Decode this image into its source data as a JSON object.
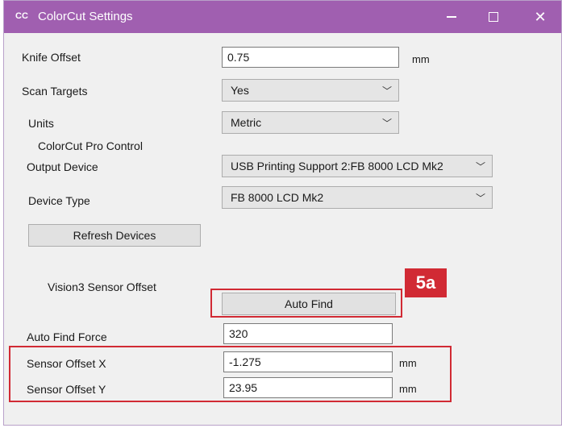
{
  "window": {
    "app_icon": "CC",
    "title": "ColorCut Settings",
    "controls": [
      "minimize-icon",
      "maximize-icon",
      "close-icon"
    ],
    "title_bar_color": "#a05fb0"
  },
  "form": {
    "knife_offset": {
      "label": "Knife Offset",
      "value": "0.75",
      "unit": "mm"
    },
    "scan_targets": {
      "label": "Scan Targets",
      "value": "Yes"
    },
    "units": {
      "label": "Units",
      "value": "Metric"
    },
    "section_colorcut": "ColorCut Pro Control",
    "output_device": {
      "label": "Output Device",
      "value": "USB Printing Support 2:FB 8000 LCD Mk2"
    },
    "device_type": {
      "label": "Device Type",
      "value": "FB 8000 LCD Mk2"
    },
    "refresh_button": "Refresh Devices",
    "section_vision": "Vision3 Sensor Offset",
    "auto_find_button": "Auto Find",
    "auto_find_force": {
      "label": "Auto Find Force",
      "value": "320"
    },
    "sensor_offset_x": {
      "label": "Sensor Offset X",
      "value": "-1.275",
      "unit": "mm"
    },
    "sensor_offset_y": {
      "label": "Sensor Offset Y",
      "value": "23.95",
      "unit": "mm"
    }
  },
  "annotation": {
    "badge": "5a",
    "highlight_color": "#d12a34"
  }
}
